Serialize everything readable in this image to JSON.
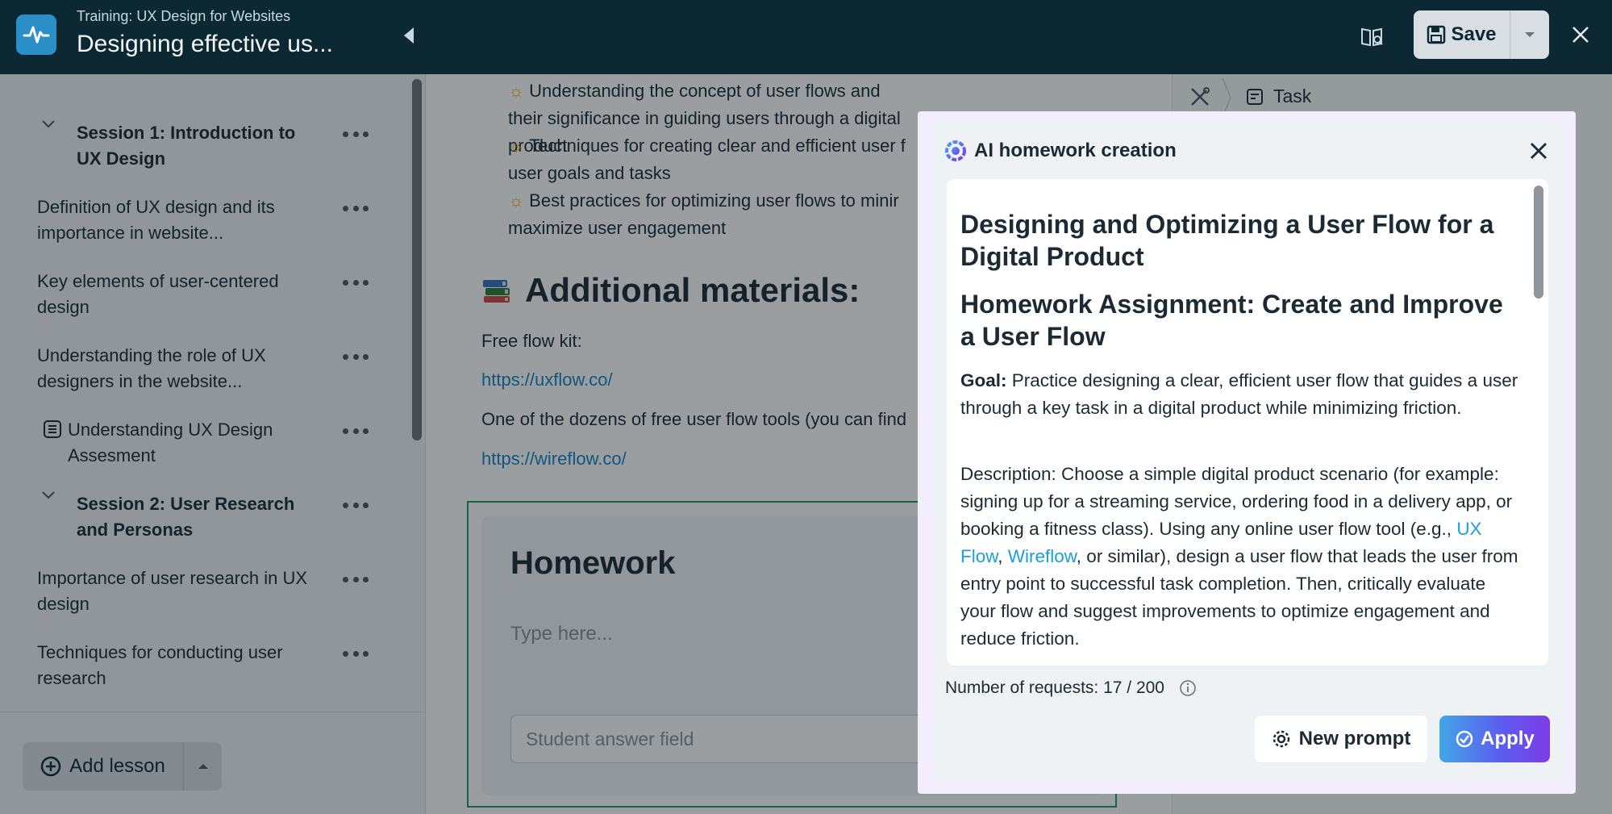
{
  "header": {
    "subtitle": "Training: UX Design for Websites",
    "title": "Designing effective us...",
    "save_label": "Save"
  },
  "sidebar": {
    "items": [
      {
        "type": "session",
        "label": "Session 1: Introduction to UX Design"
      },
      {
        "type": "lesson",
        "label": "Definition of UX design and its importance in website..."
      },
      {
        "type": "lesson",
        "label": "Key elements of user-centered design"
      },
      {
        "type": "lesson",
        "label": "Understanding the role of UX designers in the website..."
      },
      {
        "type": "assessment",
        "label": "Understanding UX Design Assesment"
      },
      {
        "type": "session",
        "label": "Session 2: User Research and Personas"
      },
      {
        "type": "lesson",
        "label": "Importance of user research in UX design"
      },
      {
        "type": "lesson",
        "label": "Techniques for conducting user research"
      }
    ],
    "add_lesson_label": "Add lesson"
  },
  "main": {
    "bullets": [
      "Understanding the concept of user flows and their significance in guiding users through a digital product",
      "Techniques for creating clear and efficient user f user goals and tasks",
      "Best practices for optimizing user flows to minir maximize user engagement"
    ],
    "additional_heading": "Additional materials:",
    "free_flow_label": "Free flow kit:",
    "link1": "https://uxflow.co/",
    "dozens_text": "One of the dozens of free user flow tools (you can find",
    "link2": "https://wireflow.co/",
    "homework_title": "Homework",
    "homework_placeholder": "Type here...",
    "student_answer_placeholder": "Student answer field"
  },
  "right_panel": {
    "task_label": "Task"
  },
  "modal": {
    "title": "AI homework creation",
    "heading1": "Designing and Optimizing a User Flow for a Digital Product",
    "heading2": "Homework Assignment: Create and Improve a User Flow",
    "goal_label": "Goal:",
    "goal_text": " Practice designing a clear, efficient user flow that guides a user through a key task in a digital product while minimizing friction.",
    "desc_start": "Description: Choose a simple digital product scenario (for example: signing up for a streaming service, ordering food in a delivery app, or booking a fitness class). Using any online user flow tool (e.g., ",
    "desc_link1": "UX Flow",
    "desc_sep": ", ",
    "desc_link2": "Wireflow",
    "desc_end": ", or similar), design a user flow that leads the user from entry point to successful task completion. Then, critically evaluate your flow and suggest improvements to optimize engagement and reduce friction.",
    "requests_text": "Number of requests: 17 / 200",
    "new_prompt_label": "New prompt",
    "apply_label": "Apply"
  },
  "colors": {
    "header_bg": "#0c2833",
    "accent_blue": "#1683c4",
    "homework_border": "#1c9e63",
    "apply_gradient_start": "#42a6e7",
    "apply_gradient_end": "#7c3ae6"
  }
}
